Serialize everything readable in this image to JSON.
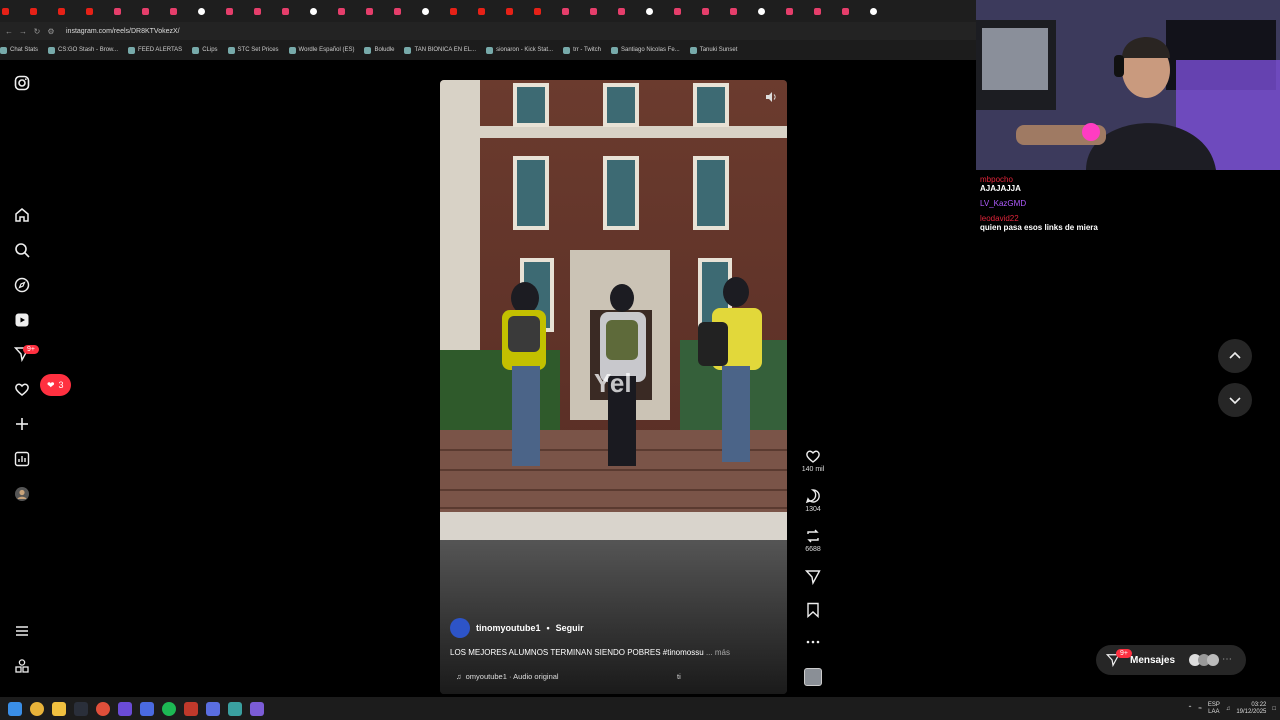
{
  "browser": {
    "url": "instagram.com/reels/DR8KTVokezX/",
    "bookmarks": [
      "Chat Stats",
      "CS:GO Stash - Brow...",
      "FEED ALERTAS",
      "CLips",
      "STC Set Prices",
      "Wordle Español (ES)",
      "Boludle",
      "TAN BIONICA EN EL...",
      "sionaron - Kick Stat...",
      "trr - Twitch",
      "Santiago Nicolas Fe...",
      "Tanuki Sunset"
    ],
    "tab_count": 32
  },
  "sidebar": {
    "explore_badge": "9+",
    "notifications_count": "3"
  },
  "reel": {
    "caption_overlay": "Yel",
    "username": "tinomyoutube1",
    "separator": "•",
    "follow_label": "Seguir",
    "caption": "LOS MEJORES ALUMNOS TERMINAN SIENDO POBRES #tinomossu",
    "more_label": "... más",
    "audio": "omyoutube1 · Audio original",
    "audio_extra": "ti"
  },
  "actions": {
    "likes": "140 mil",
    "comments": "1304",
    "reposts": "6688"
  },
  "chat": {
    "lines": [
      {
        "user": "mbpocho",
        "message": "AJAJAJJA",
        "color": "#e0243a"
      },
      {
        "user": "LV_KazGMD",
        "message": "",
        "color": "#b05cff"
      },
      {
        "user": "leodavid22",
        "message": "quien pasa esos links de miera",
        "color": "#e0243a"
      }
    ]
  },
  "messages": {
    "label": "Mensajes",
    "badge": "9+"
  },
  "taskbar": {
    "lang_top": "ESP",
    "lang_bottom": "LAA",
    "time": "03:22",
    "date": "19/12/2025"
  }
}
